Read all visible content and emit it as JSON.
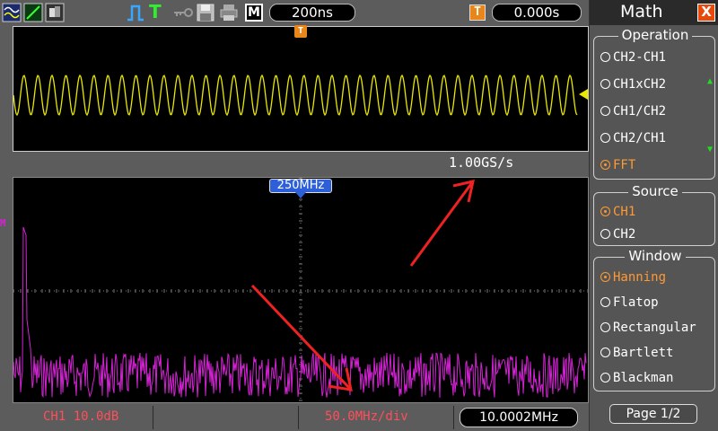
{
  "topbar": {
    "mode_label": "M",
    "timebase": "200ns",
    "trigger_icon_label": "T",
    "trigger_offset": "0.000s",
    "icons": [
      "waveform-menu-icon",
      "cursor-line-icon",
      "display-icon",
      "pulse-trigger-icon",
      "trigger-t-icon",
      "key-icon",
      "save-disk-icon",
      "print-icon"
    ]
  },
  "upper": {
    "trigger_marker": "T"
  },
  "lower": {
    "center_freq": "250MHz",
    "math_marker": "M",
    "sample_rate": "1.00GS/s"
  },
  "bottombar": {
    "channel_scale": "CH1 10.0dB",
    "freq_div": "50.0MHz/div",
    "freq_readout": "10.0002MHz"
  },
  "panel": {
    "title": "Math",
    "close_label": "X",
    "operation": {
      "title": "Operation",
      "options": [
        "CH2-CH1",
        "CH1xCH2",
        "CH1/CH2",
        "CH2/CH1",
        "FFT"
      ],
      "selected": "FFT"
    },
    "source": {
      "title": "Source",
      "options": [
        "CH1",
        "CH2"
      ],
      "selected": "CH1"
    },
    "window": {
      "title": "Window",
      "options": [
        "Hanning",
        "Flatop",
        "Rectangular",
        "Bartlett",
        "Blackman"
      ],
      "selected": "Hanning"
    },
    "page": "Page 1/2"
  },
  "colors": {
    "ch1_trace": "#e8e800",
    "math_trace": "#d622d6",
    "accent_orange": "#ff9a33",
    "annotation_arrow": "#ee2222",
    "label_red": "#ff4f5a"
  }
}
